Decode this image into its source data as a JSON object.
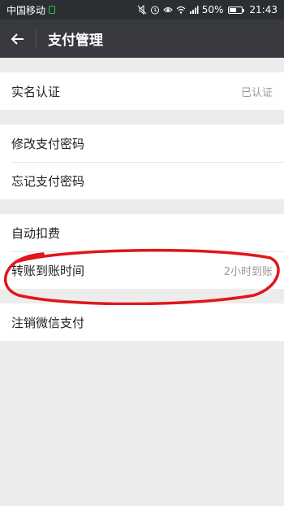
{
  "status_bar": {
    "carrier": "中国移动",
    "battery_percent": "50%",
    "battery_level": 0.5,
    "time": "21:43",
    "icons": [
      "mute-icon",
      "alarm-icon",
      "eye-icon",
      "wifi-icon",
      "signal-icon",
      "battery-icon"
    ]
  },
  "header": {
    "title": "支付管理"
  },
  "groups": [
    {
      "items": [
        {
          "label": "实名认证",
          "value": "已认证"
        }
      ]
    },
    {
      "items": [
        {
          "label": "修改支付密码"
        },
        {
          "label": "忘记支付密码"
        }
      ]
    },
    {
      "items": [
        {
          "label": "自动扣费"
        },
        {
          "label": "转账到账时间",
          "value": "2小时到账"
        }
      ]
    },
    {
      "items": [
        {
          "label": "注销微信支付"
        }
      ]
    }
  ],
  "annotation_color": "#e0161b"
}
